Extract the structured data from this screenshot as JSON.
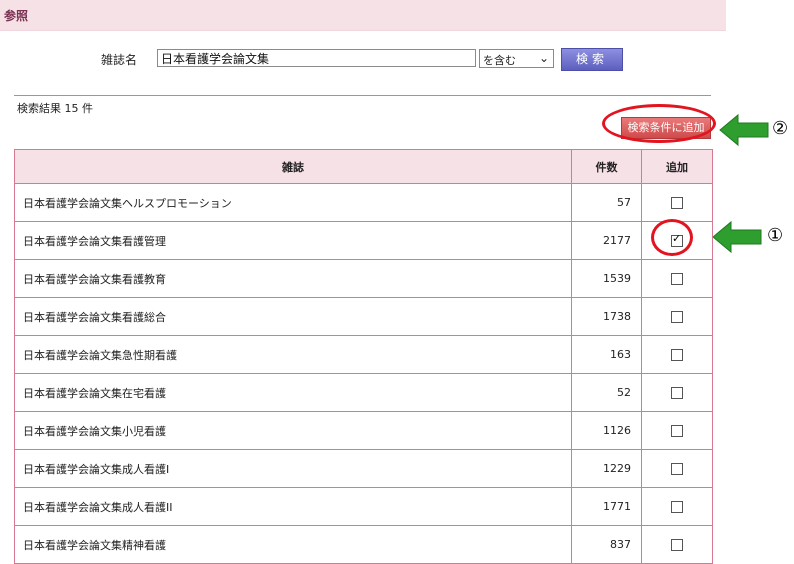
{
  "header": {
    "title": "参照"
  },
  "search": {
    "label": "雑誌名",
    "value": "日本看護学会論文集",
    "match_mode": "を含む",
    "button_label": "検索"
  },
  "results": {
    "summary": "検索結果 15 件",
    "add_button_label": "検索条件に追加",
    "columns": {
      "journal": "雑誌",
      "count": "件数",
      "add": "追加"
    },
    "rows": [
      {
        "journal": "日本看護学会論文集ヘルスプロモーション",
        "count": "57",
        "checked": false
      },
      {
        "journal": "日本看護学会論文集看護管理",
        "count": "2177",
        "checked": true
      },
      {
        "journal": "日本看護学会論文集看護教育",
        "count": "1539",
        "checked": false
      },
      {
        "journal": "日本看護学会論文集看護総合",
        "count": "1738",
        "checked": false
      },
      {
        "journal": "日本看護学会論文集急性期看護",
        "count": "163",
        "checked": false
      },
      {
        "journal": "日本看護学会論文集在宅看護",
        "count": "52",
        "checked": false
      },
      {
        "journal": "日本看護学会論文集小児看護",
        "count": "1126",
        "checked": false
      },
      {
        "journal": "日本看護学会論文集成人看護I",
        "count": "1229",
        "checked": false
      },
      {
        "journal": "日本看護学会論文集成人看護II",
        "count": "1771",
        "checked": false
      },
      {
        "journal": "日本看護学会論文集精神看護",
        "count": "837",
        "checked": false
      }
    ]
  },
  "annotations": {
    "marker_1": "①",
    "marker_2": "②",
    "arrow_color": "#2e9e2e",
    "highlight_color": "#e2141f"
  }
}
